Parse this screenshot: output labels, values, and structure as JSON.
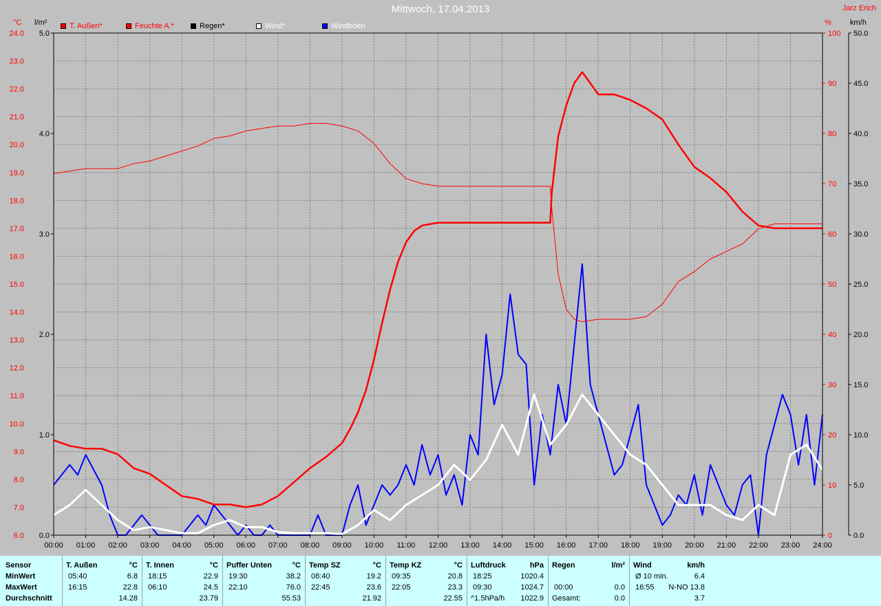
{
  "header": {
    "title": "Mittwoch, 17.04.2013",
    "author": "Jarz Erich",
    "unit_left_1": "°C",
    "unit_left_2": "l/m²",
    "unit_right_1": "%",
    "unit_right_2": "km/h"
  },
  "legend": [
    {
      "label": "T. Außen*",
      "color": "#ff0000",
      "text_color": "#ff0000"
    },
    {
      "label": "Feuchte A.*",
      "color": "#ff0000",
      "text_color": "#ff0000"
    },
    {
      "label": "Regen*",
      "color": "#000000",
      "text_color": "#000000"
    },
    {
      "label": "Wind*",
      "color": "#ffffff",
      "text_color": "#ffffff"
    },
    {
      "label": "Windböen",
      "color": "#0000ff",
      "text_color": "#ffffff"
    }
  ],
  "colors": {
    "temp": "#ff0000",
    "humidity": "#ff0000",
    "wind": "#ffffff",
    "gusts": "#0000ff",
    "plot_bg": "#c0c0c0",
    "grid": "#808080"
  },
  "chart_data": {
    "type": "line",
    "x_ticks": [
      "00:00",
      "01:00",
      "02:00",
      "03:00",
      "04:00",
      "05:00",
      "06:00",
      "07:00",
      "08:00",
      "09:00",
      "10:00",
      "11:00",
      "12:00",
      "13:00",
      "14:00",
      "15:00",
      "16:00",
      "17:00",
      "18:00",
      "19:00",
      "20:00",
      "21:00",
      "22:00",
      "23:00",
      "24:00"
    ],
    "axes": {
      "temp_c": {
        "range": [
          6.0,
          24.0
        ],
        "ticks": [
          "6.0",
          "7.0",
          "8.0",
          "9.0",
          "10.0",
          "11.0",
          "12.0",
          "13.0",
          "14.0",
          "15.0",
          "16.0",
          "17.0",
          "18.0",
          "19.0",
          "20.0",
          "21.0",
          "22.0",
          "23.0",
          "24.0"
        ]
      },
      "rain_lm2": {
        "range": [
          0.0,
          5.0
        ],
        "ticks": [
          "0.0",
          "1.0",
          "2.0",
          "3.0",
          "4.0",
          "5.0"
        ]
      },
      "humidity_pct": {
        "range": [
          0,
          100
        ],
        "ticks": [
          "0",
          "10",
          "20",
          "30",
          "40",
          "50",
          "60",
          "70",
          "80",
          "90",
          "100"
        ]
      },
      "wind_kmh": {
        "range": [
          0.0,
          50.0
        ],
        "ticks": [
          "0.0",
          "5.0",
          "10.0",
          "15.0",
          "20.0",
          "25.0",
          "30.0",
          "35.0",
          "40.0",
          "45.0",
          "50.0"
        ]
      }
    },
    "grid": true,
    "series": [
      {
        "name": "T. Außen",
        "axis": "temp_c",
        "x": [
          0,
          0.5,
          1,
          1.5,
          2,
          2.5,
          3,
          3.5,
          4,
          4.5,
          5,
          5.5,
          6,
          6.5,
          7,
          7.5,
          8,
          8.5,
          9,
          9.25,
          9.5,
          9.75,
          10,
          10.25,
          10.5,
          10.75,
          11,
          11.25,
          11.5,
          12,
          12.5,
          13,
          14,
          15,
          15.5,
          15.55,
          15.75,
          16,
          16.25,
          16.5,
          16.75,
          17,
          17.5,
          18,
          18.5,
          19,
          19.5,
          20,
          20.5,
          21,
          21.5,
          22,
          22.5,
          23,
          23.5,
          24
        ],
        "y": [
          9.4,
          9.2,
          9.1,
          9.1,
          8.9,
          8.4,
          8.2,
          7.8,
          7.4,
          7.3,
          7.1,
          7.1,
          7.0,
          7.1,
          7.4,
          7.9,
          8.4,
          8.8,
          9.3,
          9.8,
          10.4,
          11.2,
          12.3,
          13.6,
          14.8,
          15.8,
          16.5,
          16.9,
          17.1,
          17.2,
          17.2,
          17.2,
          17.2,
          17.2,
          17.2,
          18.3,
          20.3,
          21.4,
          22.2,
          22.6,
          22.2,
          21.8,
          21.8,
          21.6,
          21.3,
          20.9,
          20.0,
          19.2,
          18.8,
          18.3,
          17.6,
          17.1,
          17.0,
          17.0,
          17.0,
          17.0
        ]
      },
      {
        "name": "Feuchte A.",
        "axis": "humidity_pct",
        "x": [
          0,
          0.5,
          1,
          1.5,
          2,
          2.5,
          3,
          3.5,
          4,
          4.5,
          5,
          5.5,
          6,
          6.5,
          7,
          7.5,
          8,
          8.5,
          9,
          9.5,
          10,
          10.5,
          11,
          11.5,
          12,
          13,
          14,
          15,
          15.5,
          15.55,
          15.75,
          16,
          16.25,
          16.5,
          17,
          17.5,
          18,
          18.5,
          19,
          19.5,
          20,
          20.5,
          21,
          21.5,
          22,
          22.5,
          23,
          23.5,
          24
        ],
        "y": [
          72,
          72.5,
          73,
          73,
          73,
          74,
          74.5,
          75.5,
          76.5,
          77.5,
          79,
          79.5,
          80.5,
          81,
          81.5,
          81.5,
          82,
          82,
          81.5,
          80.5,
          78,
          74,
          71,
          70,
          69.5,
          69.5,
          69.5,
          69.5,
          69.5,
          65,
          52,
          45,
          43,
          42.5,
          43,
          43,
          43,
          43.5,
          46,
          50.5,
          52.5,
          55,
          56.5,
          58,
          61,
          62,
          62,
          62,
          62
        ]
      },
      {
        "name": "Wind",
        "axis": "wind_kmh",
        "x": [
          0,
          0.5,
          1,
          1.5,
          2,
          2.5,
          3,
          3.5,
          4,
          4.5,
          5,
          5.5,
          6,
          6.5,
          7,
          7.5,
          8,
          8.5,
          9,
          9.5,
          10,
          10.5,
          11,
          11.5,
          12,
          12.5,
          13,
          13.5,
          14,
          14.5,
          15,
          15.5,
          16,
          16.5,
          17,
          17.5,
          18,
          18.5,
          19,
          19.5,
          20,
          20.5,
          21,
          21.5,
          22,
          22.5,
          23,
          23.5,
          24
        ],
        "y": [
          2,
          3,
          4.5,
          3,
          1.5,
          0.5,
          0.8,
          0.5,
          0.2,
          0.2,
          1,
          1.5,
          0.8,
          0.8,
          0.3,
          0.2,
          0.2,
          0.2,
          0.1,
          1,
          2.5,
          1.5,
          3,
          4,
          5,
          7,
          5.5,
          7.5,
          11,
          8,
          14,
          9,
          11,
          14,
          12,
          10,
          8,
          7,
          5,
          3,
          3,
          3,
          2,
          1.5,
          3,
          2,
          8,
          9,
          6.5
        ]
      },
      {
        "name": "Windböen",
        "axis": "wind_kmh",
        "x": [
          0,
          0.25,
          0.5,
          0.75,
          1,
          1.25,
          1.5,
          1.75,
          2,
          2.25,
          2.5,
          2.75,
          3,
          3.25,
          3.5,
          3.75,
          4,
          4.25,
          4.5,
          4.75,
          5,
          5.25,
          5.5,
          5.75,
          6,
          6.25,
          6.5,
          6.75,
          7,
          7.25,
          7.5,
          7.75,
          8,
          8.25,
          8.5,
          8.75,
          9,
          9.25,
          9.5,
          9.75,
          10,
          10.25,
          10.5,
          10.75,
          11,
          11.25,
          11.5,
          11.75,
          12,
          12.25,
          12.5,
          12.75,
          13,
          13.25,
          13.5,
          13.75,
          14,
          14.25,
          14.5,
          14.75,
          15,
          15.25,
          15.5,
          15.75,
          16,
          16.25,
          16.5,
          16.75,
          17,
          17.25,
          17.5,
          17.75,
          18,
          18.25,
          18.5,
          18.75,
          19,
          19.25,
          19.5,
          19.75,
          20,
          20.25,
          20.5,
          20.75,
          21,
          21.25,
          21.5,
          21.75,
          22,
          22.25,
          22.5,
          22.75,
          23,
          23.25,
          23.5,
          23.75,
          24
        ],
        "y": [
          5,
          6,
          7,
          6,
          8,
          6.5,
          5,
          2,
          0,
          0,
          1,
          2,
          1,
          0,
          0,
          0,
          0,
          1,
          2,
          1,
          3,
          2,
          1,
          0,
          1,
          0,
          0,
          1,
          0,
          0,
          0,
          0,
          0,
          2,
          0,
          0,
          0,
          3,
          5,
          1,
          3,
          5,
          4,
          5,
          7,
          5,
          9,
          6,
          8,
          4,
          6,
          3,
          10,
          8,
          20,
          13,
          16,
          24,
          18,
          17,
          5,
          12,
          8,
          15,
          11,
          19,
          27,
          15,
          12,
          9,
          6,
          7,
          10,
          13,
          5,
          3,
          1,
          2,
          4,
          3,
          6,
          2,
          7,
          5,
          3,
          2,
          5,
          6,
          0,
          8,
          11,
          14,
          12,
          7,
          12,
          5,
          12
        ]
      }
    ]
  },
  "stats": {
    "row_labels": {
      "sensor": "Sensor",
      "min": "MinWert",
      "max": "MaxWert",
      "avg": "Durchschnitt"
    },
    "columns": [
      {
        "name": "T. Außen",
        "unit": "°C",
        "min_time": "05:40",
        "min_val": "6.8",
        "max_time": "16:15",
        "max_val": "22.8",
        "avg": "14.28"
      },
      {
        "name": "T. Innen",
        "unit": "°C",
        "min_time": "18:15",
        "min_val": "22.9",
        "max_time": "06:10",
        "max_val": "24.5",
        "avg": "23.79"
      },
      {
        "name": "Puffer Unten",
        "unit": "°C",
        "min_time": "19:30",
        "min_val": "38.2",
        "max_time": "22:10",
        "max_val": "76.0",
        "avg": "55.53"
      },
      {
        "name": "Temp SZ",
        "unit": "°C",
        "min_time": "08:40",
        "min_val": "19.2",
        "max_time": "22:45",
        "max_val": "23.6",
        "avg": "21.92"
      },
      {
        "name": "Temp KZ",
        "unit": "°C",
        "min_time": "09:35",
        "min_val": "20.8",
        "max_time": "22:05",
        "max_val": "23.3",
        "avg": "22.55"
      },
      {
        "name": "Luftdruck",
        "unit": "hPa",
        "min_time": "18:25",
        "min_val": "1020.4",
        "max_time": "09:30",
        "max_val": "1024.7",
        "avg_label": "^1.5hPa/h",
        "avg": "1022.9"
      },
      {
        "name": "Regen",
        "unit": "l/m²",
        "min_time": "",
        "min_val": "",
        "max_time": "00:00",
        "max_val": "0.0",
        "avg_label": "Gesamt:",
        "avg": "0.0"
      },
      {
        "name": "Wind",
        "unit": "km/h",
        "min_time": "Ø 10 min.",
        "min_val": "6.4",
        "max_time": "16:55",
        "max_val": "N-NO 13.8",
        "avg": "3.7"
      }
    ]
  }
}
